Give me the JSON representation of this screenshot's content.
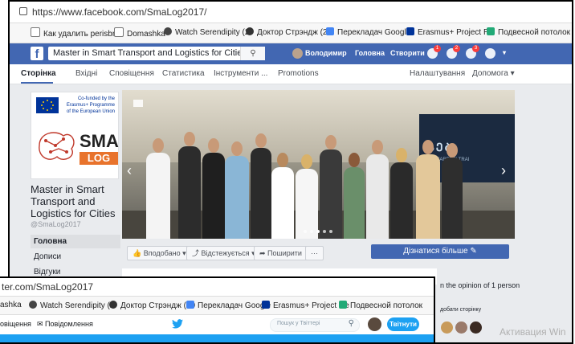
{
  "facebook": {
    "url": "https://www.facebook.com/SmaLog2017/",
    "bookmarks": [
      {
        "label": "Как удалить perisbri",
        "color": "#777"
      },
      {
        "label": "Domashka",
        "color": "#777"
      },
      {
        "label": "Watch Serendipity (2",
        "color": "#444"
      },
      {
        "label": "Доктор Стрэндж (20",
        "color": "#333"
      },
      {
        "label": "Перекладач Google",
        "color": "#4285f4"
      },
      {
        "label": "Erasmus+ Project Re",
        "color": "#003399"
      },
      {
        "label": "Подвесной потолок",
        "color": "#2a7"
      }
    ],
    "search_value": "Master in Smart Transport and Logistics for Cities",
    "nav": {
      "user": "Володимир",
      "home": "Головна",
      "create": "Створити",
      "badges": [
        "1",
        "2",
        "3"
      ]
    },
    "tabs": [
      "Сторінка",
      "Вхідні",
      "Сповіщення",
      "Статистика",
      "Інструменти ...",
      "Promotions",
      "Налаштування",
      "Допомога ▾"
    ],
    "eu_text": "Co-funded by the Erasmus+ Programme of the European Union",
    "logo_text": {
      "sma": "SMA",
      "log": "LOG"
    },
    "page_name": "Master in Smart Transport and Logistics for Cities",
    "handle": "@SmaLog2017",
    "left_menu": [
      "Головна",
      "Дописи",
      "Відгуки"
    ],
    "cover_screen": {
      "title": "ᲡᲔᲑ",
      "sub": "SEAFARERS' TRAI"
    },
    "actions": {
      "liked": "Вподобано ▾",
      "follow": "Відстежується ▾",
      "share": "Поширити",
      "more": "···",
      "learn_more": "Дізнатися більше ✎"
    },
    "opinion": "n the opinion of 1 person",
    "like_page": "добати сторінку",
    "watermark": "Активация Win"
  },
  "twitter": {
    "url": "ter.com/SmaLog2017",
    "bookmarks": [
      {
        "label": "ashka",
        "color": "#777"
      },
      {
        "label": "Watch Serendipity (2",
        "color": "#444"
      },
      {
        "label": "Доктор Стрэндж (20",
        "color": "#333"
      },
      {
        "label": "Перекладач Google",
        "color": "#4285f4"
      },
      {
        "label": "Erasmus+ Project Re",
        "color": "#003399"
      },
      {
        "label": "Подвесной потолок",
        "color": "#2a7"
      }
    ],
    "nav": {
      "notifications": "овіщення",
      "messages": "Повідомлення"
    },
    "search_placeholder": "Пошук у Твіттері",
    "tweet_button": "Твітнути"
  },
  "colors": {
    "fb_blue": "#4267b2",
    "twitter_blue": "#1da1f2"
  }
}
